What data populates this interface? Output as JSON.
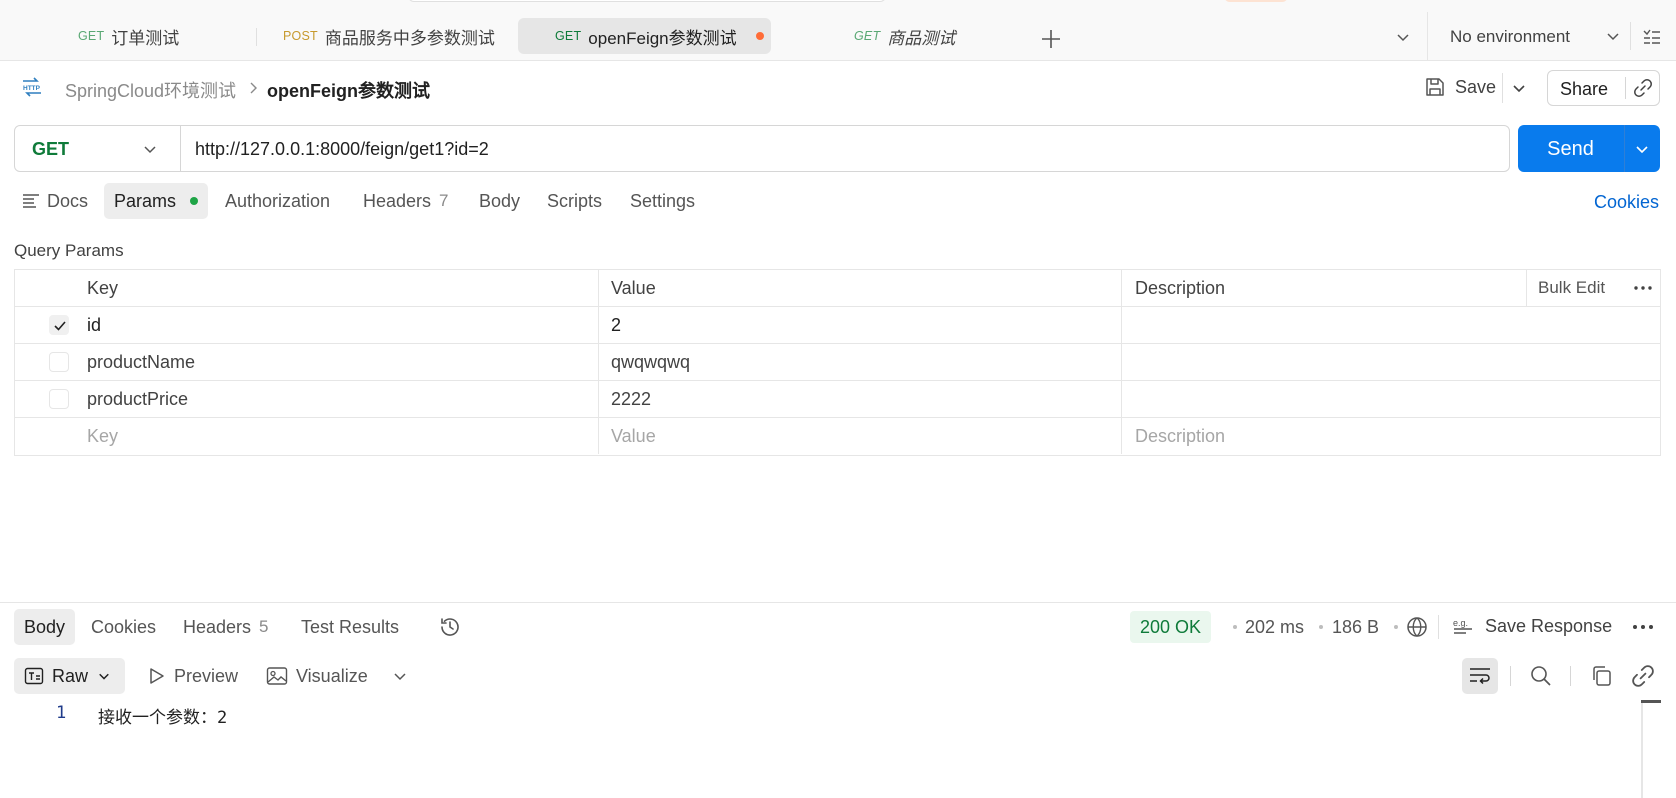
{
  "tabs": [
    {
      "method": "GET",
      "title": "订单测试",
      "method_color": "#1e9e4f"
    },
    {
      "method": "POST",
      "title": "商品服务中多参数测试",
      "method_color": "#c79a2e"
    },
    {
      "method": "GET",
      "title": "openFeign参数测试",
      "method_color": "#0f7b3a",
      "active": true,
      "unsaved": true
    },
    {
      "method": "GET",
      "title": "商品测试",
      "method_color": "#1e9e4f",
      "preview": true
    }
  ],
  "environment": {
    "selected": "No environment"
  },
  "breadcrumb": {
    "collection": "SpringCloud环境测试",
    "request": "openFeign参数测试"
  },
  "header_actions": {
    "save": "Save",
    "share": "Share"
  },
  "request": {
    "method": "GET",
    "url": "http://127.0.0.1:8000/feign/get1?id=2",
    "send": "Send"
  },
  "request_tabs": {
    "docs": "Docs",
    "params": "Params",
    "authorization": "Authorization",
    "headers": "Headers",
    "headers_count": "7",
    "body": "Body",
    "scripts": "Scripts",
    "settings": "Settings",
    "cookies": "Cookies"
  },
  "query_params": {
    "title": "Query Params",
    "columns": {
      "key": "Key",
      "value": "Value",
      "description": "Description"
    },
    "bulk_edit": "Bulk Edit",
    "rows": [
      {
        "key": "id",
        "value": "2",
        "description": "",
        "checked": true
      },
      {
        "key": "productName",
        "value": "qwqwqwq",
        "description": "",
        "checked": false
      },
      {
        "key": "productPrice",
        "value": "2222",
        "description": "",
        "checked": false
      }
    ],
    "placeholders": {
      "key": "Key",
      "value": "Value",
      "description": "Description"
    }
  },
  "response": {
    "tabs": {
      "body": "Body",
      "cookies": "Cookies",
      "headers": "Headers",
      "headers_count": "5",
      "test_results": "Test Results"
    },
    "status": "200 OK",
    "time": "202 ms",
    "size": "186 B",
    "save_response": "Save Response",
    "format": "Raw",
    "preview": "Preview",
    "visualize": "Visualize",
    "lines": [
      {
        "no": "1",
        "text": "接收一个参数：2"
      }
    ]
  },
  "colors": {
    "accent": "#097bed",
    "status_ok": "#0f7b3a",
    "unsaved_dot": "#ff6c37"
  }
}
